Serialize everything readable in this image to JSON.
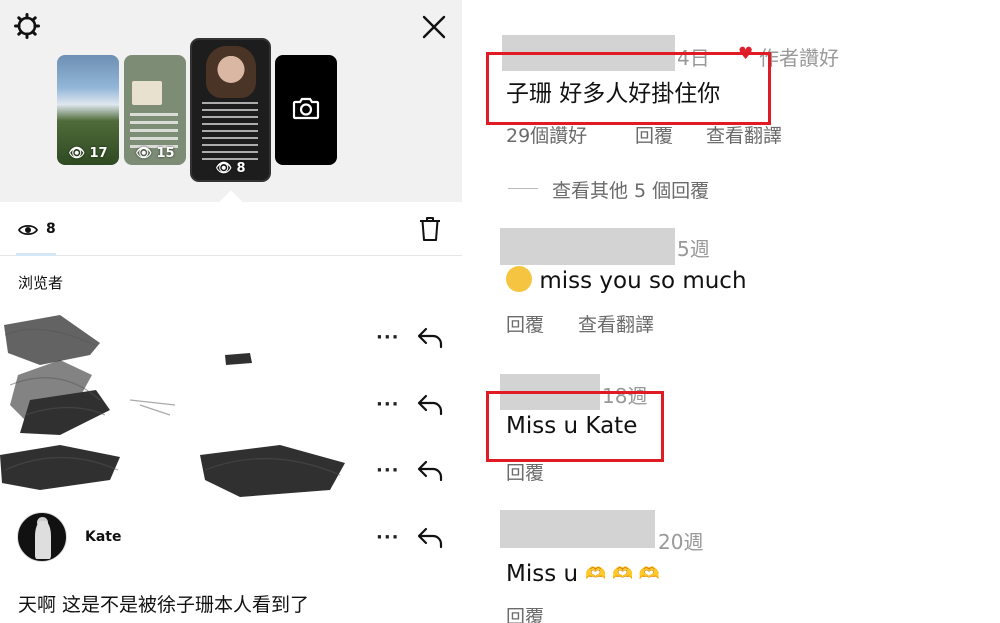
{
  "left_panel": {
    "story_thumbnails": [
      {
        "views": "17"
      },
      {
        "views": "15"
      },
      {
        "views": "8"
      }
    ],
    "viewer_count": "8",
    "viewers_label": "浏览者",
    "viewers": [
      {
        "name": "Kate"
      }
    ],
    "caption": "天啊 这是不是被徐子珊本人看到了",
    "icons": {
      "settings": "gear-icon",
      "close": "close-icon",
      "camera": "camera-icon",
      "eye": "eye-icon",
      "trash": "trash-icon",
      "more": "more-icon",
      "reply": "reply-icon"
    }
  },
  "right_panel": {
    "comments": [
      {
        "time": "4日",
        "liked_label": "作者讚好",
        "text": "子珊 好多人好掛住你",
        "likes": "29個讚好",
        "reply_label": "回覆",
        "translate_label": "查看翻譯"
      },
      {
        "time": "5週",
        "text": "miss you so much",
        "reply_label": "回覆",
        "translate_label": "查看翻譯"
      },
      {
        "time": "18週",
        "text": "Miss u Kate",
        "reply_label": "回覆"
      },
      {
        "time": "20週",
        "text": "Miss u",
        "reply_label": "回覆"
      }
    ],
    "view_more_replies": "查看其他 5 個回覆",
    "highlight_color": "#e01b24",
    "heart_color": "#e0202e"
  }
}
